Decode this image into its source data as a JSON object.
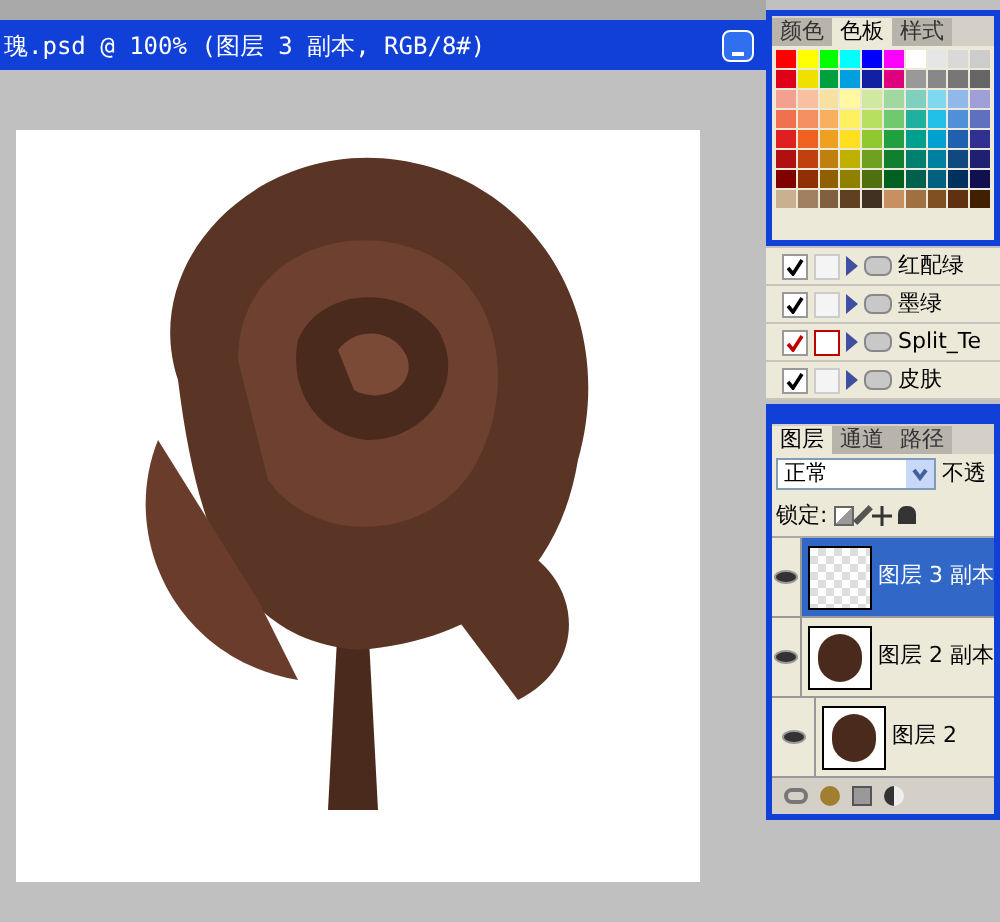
{
  "document": {
    "title": "瑰.psd @ 100% (图层 3 副本, RGB/8#)"
  },
  "swatches_panel": {
    "tabs": [
      {
        "label": "颜色",
        "selected": false
      },
      {
        "label": "色板",
        "selected": true
      },
      {
        "label": "样式",
        "selected": false
      }
    ]
  },
  "layer_sets": [
    {
      "name": "红配绿",
      "checked": true,
      "flagged": false
    },
    {
      "name": "墨绿",
      "checked": true,
      "flagged": false
    },
    {
      "name": "Split_Te",
      "checked": true,
      "flagged": true
    },
    {
      "name": "皮肤",
      "checked": true,
      "flagged": false
    }
  ],
  "layers_panel": {
    "tabs": [
      {
        "label": "图层",
        "selected": true
      },
      {
        "label": "通道",
        "selected": false
      },
      {
        "label": "路径",
        "selected": false
      }
    ],
    "blend_mode": "正常",
    "opacity_label": "不透",
    "lock_label": "锁定:",
    "layers": [
      {
        "name": "图层 3 副本",
        "visible": true,
        "selected": true,
        "kind": "empty"
      },
      {
        "name": "图层 2 副本",
        "visible": true,
        "selected": false,
        "kind": "rose"
      },
      {
        "name": "图层 2",
        "visible": true,
        "selected": false,
        "kind": "rose"
      }
    ]
  }
}
